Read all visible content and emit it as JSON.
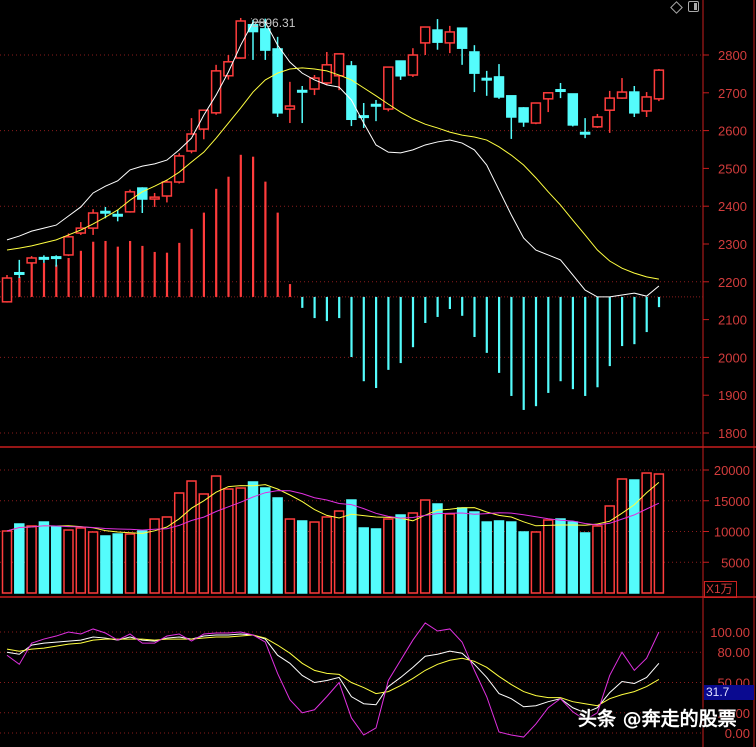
{
  "colors": {
    "up": "#ff3c3c",
    "down": "#54fcfc",
    "ma_white": "#ffffff",
    "ma_yellow": "#ffff40",
    "ma_magenta": "#e030e0",
    "grid": "#8a1c1c",
    "axis": "#c81e1e",
    "label": "#d23c3c"
  },
  "toolbar": {
    "icons": [
      "diamond-icon",
      "panel-toggle-icon"
    ]
  },
  "watermark": "头条 @奔走的股票",
  "chart_data": [
    {
      "type": "candlestick",
      "pane": "price",
      "yticks": [
        "2800",
        "2700",
        "2600",
        "2500",
        "2400",
        "2300",
        "2200",
        "2100",
        "2000",
        "1900",
        "1800"
      ],
      "ylim": [
        1800,
        2800
      ],
      "grid": true,
      "high_annotation": "2896.31",
      "candles": [
        [
          2147,
          2218,
          2145,
          2210
        ],
        [
          2224,
          2258,
          2210,
          2223
        ],
        [
          2250,
          2268,
          2245,
          2263
        ],
        [
          2264,
          2270,
          2250,
          2263
        ],
        [
          2266,
          2270,
          2240,
          2265
        ],
        [
          2271,
          2328,
          2268,
          2319
        ],
        [
          2329,
          2358,
          2324,
          2342
        ],
        [
          2342,
          2392,
          2324,
          2382
        ],
        [
          2386,
          2398,
          2368,
          2385
        ],
        [
          2378,
          2390,
          2360,
          2377
        ],
        [
          2385,
          2444,
          2383,
          2438
        ],
        [
          2448,
          2450,
          2382,
          2419
        ],
        [
          2419,
          2435,
          2398,
          2424
        ],
        [
          2427,
          2470,
          2410,
          2464
        ],
        [
          2464,
          2540,
          2460,
          2533
        ],
        [
          2546,
          2633,
          2540,
          2591
        ],
        [
          2604,
          2654,
          2577,
          2654
        ],
        [
          2647,
          2774,
          2642,
          2758
        ],
        [
          2745,
          2800,
          2735,
          2782
        ],
        [
          2792,
          2898,
          2790,
          2890
        ],
        [
          2880,
          2893,
          2787,
          2862
        ],
        [
          2869,
          2896.31,
          2787,
          2813
        ],
        [
          2816,
          2848,
          2636,
          2647
        ],
        [
          2657,
          2729,
          2620,
          2665
        ],
        [
          2706,
          2718,
          2620,
          2705
        ],
        [
          2710,
          2747,
          2694,
          2739
        ],
        [
          2726,
          2808,
          2720,
          2774
        ],
        [
          2745,
          2803,
          2707,
          2803
        ],
        [
          2771,
          2784,
          2612,
          2630
        ],
        [
          2639,
          2673,
          2607,
          2638
        ],
        [
          2669,
          2681,
          2625,
          2668
        ],
        [
          2657,
          2768,
          2651,
          2768
        ],
        [
          2784,
          2784,
          2734,
          2745
        ],
        [
          2747,
          2818,
          2742,
          2800
        ],
        [
          2832,
          2874,
          2800,
          2874
        ],
        [
          2866,
          2895,
          2814,
          2834
        ],
        [
          2832,
          2877,
          2805,
          2861
        ],
        [
          2871,
          2871,
          2774,
          2818
        ],
        [
          2808,
          2826,
          2702,
          2752
        ],
        [
          2738,
          2758,
          2692,
          2737
        ],
        [
          2742,
          2776,
          2684,
          2689
        ],
        [
          2692,
          2692,
          2578,
          2636
        ],
        [
          2660,
          2662,
          2610,
          2623
        ],
        [
          2620,
          2673,
          2617,
          2673
        ],
        [
          2684,
          2700,
          2649,
          2700
        ],
        [
          2708,
          2726,
          2686,
          2707
        ],
        [
          2697,
          2697,
          2611,
          2615
        ],
        [
          2595,
          2633,
          2580,
          2594
        ],
        [
          2610,
          2644,
          2607,
          2636
        ],
        [
          2654,
          2705,
          2594,
          2686
        ],
        [
          2686,
          2739,
          2684,
          2702
        ],
        [
          2702,
          2718,
          2636,
          2647
        ],
        [
          2652,
          2702,
          2636,
          2689
        ],
        [
          2684,
          2763,
          2678,
          2760
        ]
      ],
      "lines": [
        {
          "color": "white",
          "values": [
            2311,
            2321,
            2334,
            2342,
            2350,
            2374,
            2398,
            2435,
            2453,
            2467,
            2496,
            2506,
            2512,
            2522,
            2549,
            2580,
            2641,
            2694,
            2755,
            2826,
            2887,
            2887,
            2826,
            2781,
            2752,
            2734,
            2721,
            2715,
            2681,
            2620,
            2562,
            2543,
            2541,
            2549,
            2562,
            2570,
            2575,
            2567,
            2549,
            2509,
            2443,
            2377,
            2316,
            2284,
            2271,
            2258,
            2218,
            2178,
            2160,
            2160,
            2165,
            2170,
            2162,
            2189
          ]
        },
        {
          "color": "yellow",
          "values": [
            2284,
            2289,
            2295,
            2303,
            2311,
            2324,
            2337,
            2353,
            2371,
            2390,
            2416,
            2438,
            2453,
            2469,
            2490,
            2517,
            2543,
            2580,
            2620,
            2660,
            2702,
            2734,
            2752,
            2763,
            2766,
            2763,
            2758,
            2747,
            2734,
            2713,
            2692,
            2670,
            2649,
            2631,
            2617,
            2607,
            2596,
            2588,
            2583,
            2575,
            2557,
            2535,
            2509,
            2475,
            2438,
            2403,
            2363,
            2324,
            2284,
            2255,
            2236,
            2223,
            2213,
            2207
          ]
        }
      ],
      "macd_zero": 2160,
      "macd_hist": [
        0,
        53,
        98,
        90,
        85,
        103,
        122,
        146,
        148,
        133,
        148,
        135,
        119,
        117,
        143,
        180,
        223,
        286,
        318,
        376,
        371,
        305,
        223,
        34,
        -29,
        -56,
        -64,
        -56,
        -159,
        -223,
        -241,
        -193,
        -175,
        -133,
        -69,
        -53,
        -32,
        -50,
        -106,
        -148,
        -201,
        -262,
        -299,
        -289,
        -254,
        -223,
        -244,
        -262,
        -239,
        -183,
        -130,
        -125,
        -93,
        -27
      ]
    },
    {
      "type": "bar",
      "pane": "volume",
      "unit": "X1万",
      "yticks": [
        "20000",
        "15000",
        "10000",
        "5000"
      ],
      "ylim": [
        0,
        20000
      ],
      "values": [
        10080,
        11220,
        10900,
        11540,
        10730,
        10240,
        10570,
        9920,
        9270,
        9590,
        9590,
        10080,
        12030,
        12360,
        16260,
        18210,
        16100,
        19020,
        16910,
        17070,
        18050,
        17070,
        15450,
        12030,
        11710,
        11540,
        12360,
        13330,
        15120,
        10570,
        10410,
        12030,
        12680,
        13010,
        15120,
        14470,
        12850,
        13820,
        13170,
        11540,
        11710,
        11540,
        9920,
        9920,
        11870,
        12030,
        11540,
        9760,
        10900,
        14150,
        18540,
        18370,
        19510,
        19350
      ],
      "ma_periods": [
        5,
        10
      ]
    },
    {
      "type": "line",
      "pane": "kdj",
      "yticks": [
        "100.00",
        "80.00",
        "50.00",
        "20.00",
        "0.00"
      ],
      "ylim": [
        0,
        100
      ],
      "current_marker": "31.7",
      "series": [
        {
          "color": "white",
          "values": [
            80,
            78,
            87,
            89,
            90,
            91,
            92,
            95,
            94,
            92,
            95,
            92,
            91,
            94,
            95,
            93,
            96,
            97,
            97,
            98,
            97,
            93,
            77,
            69,
            57,
            50,
            52,
            55,
            36,
            29,
            28,
            46,
            55,
            65,
            76,
            78,
            81,
            79,
            68,
            55,
            39,
            34,
            26,
            27,
            31,
            34,
            25,
            20,
            25,
            40,
            51,
            49,
            55,
            69
          ]
        },
        {
          "color": "yellow",
          "values": [
            83,
            81,
            83,
            84,
            86,
            88,
            89,
            92,
            93,
            93,
            93,
            93,
            92,
            93,
            93,
            93,
            94,
            95,
            95,
            96,
            97,
            94,
            87,
            79,
            69,
            62,
            59,
            58,
            50,
            45,
            39,
            41,
            47,
            54,
            62,
            68,
            72,
            74,
            71,
            65,
            56,
            48,
            41,
            37,
            35,
            35,
            31,
            29,
            27,
            34,
            38,
            41,
            46,
            53
          ]
        },
        {
          "color": "magenta",
          "values": [
            77,
            68,
            89,
            93,
            96,
            100,
            98,
            103,
            99,
            92,
            98,
            89,
            89,
            96,
            98,
            91,
            98,
            99,
            99,
            100,
            97,
            90,
            59,
            33,
            20,
            23,
            36,
            50,
            15,
            -2,
            5,
            52,
            72,
            92,
            109,
            101,
            103,
            90,
            62,
            36,
            1,
            -2,
            -4,
            9,
            25,
            34,
            21,
            13,
            20,
            57,
            80,
            62,
            74,
            100
          ]
        }
      ]
    }
  ]
}
